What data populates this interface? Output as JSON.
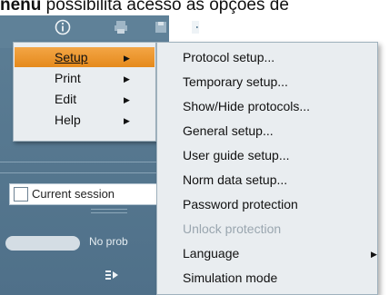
{
  "caption": {
    "bold_text": "nenu",
    "rest_text": " possibilita acesso às opções de"
  },
  "toolbar": {
    "icons": [
      "info-icon",
      "printer-icon",
      "save-icon",
      "door-icon"
    ]
  },
  "menu": {
    "items": [
      {
        "label": "Setup",
        "has_submenu": true,
        "active": true
      },
      {
        "label": "Print",
        "has_submenu": true
      },
      {
        "label": "Edit",
        "has_submenu": true
      },
      {
        "label": "Help",
        "has_submenu": true
      }
    ]
  },
  "submenu": {
    "items": [
      {
        "label": "Protocol setup..."
      },
      {
        "label": "Temporary setup..."
      },
      {
        "label": "Show/Hide protocols..."
      },
      {
        "label": "General setup..."
      },
      {
        "label": "User guide setup..."
      },
      {
        "label": "Norm data setup..."
      },
      {
        "label": "Password protection"
      },
      {
        "label": "Unlock protection",
        "disabled": true
      },
      {
        "label": "Language",
        "has_submenu": true
      },
      {
        "label": "Simulation mode"
      }
    ]
  },
  "panel": {
    "current_session_label": "Current session",
    "status_text": "No prob"
  },
  "colors": {
    "active_item": "#f0a040",
    "panel_bg": "#5a7c93",
    "menu_bg": "#e9edf0"
  }
}
